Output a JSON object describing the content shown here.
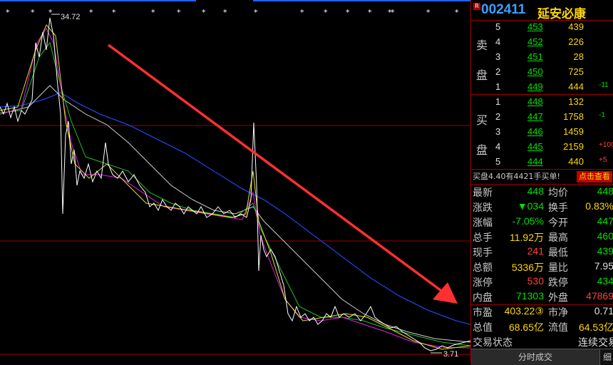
{
  "stock": {
    "code": "002411",
    "name": "延安必康",
    "badge": "R"
  },
  "chart": {
    "high_label": "34.72",
    "low_label": "3.71"
  },
  "orderbook": {
    "sell_label_1": "卖",
    "sell_label_2": "盘",
    "buy_label_1": "买",
    "buy_label_2": "盘",
    "asks": [
      {
        "level": "5",
        "price": "453",
        "volume": "439",
        "change": ""
      },
      {
        "level": "4",
        "price": "452",
        "volume": "226",
        "change": ""
      },
      {
        "level": "3",
        "price": "451",
        "volume": "28",
        "change": ""
      },
      {
        "level": "2",
        "price": "450",
        "volume": "725",
        "change": ""
      },
      {
        "level": "1",
        "price": "449",
        "volume": "444",
        "change": "-11"
      }
    ],
    "bids": [
      {
        "level": "1",
        "price": "448",
        "volume": "132",
        "change": ""
      },
      {
        "level": "2",
        "price": "447",
        "volume": "1758",
        "change": "-1"
      },
      {
        "level": "3",
        "price": "446",
        "volume": "1459",
        "change": ""
      },
      {
        "level": "4",
        "price": "445",
        "volume": "2159",
        "change": "+100"
      },
      {
        "level": "5",
        "price": "444",
        "volume": "440",
        "change": "+5"
      }
    ]
  },
  "notice": {
    "text": "买盘4.40有4421手买单!",
    "button": "点击查看"
  },
  "stats": [
    {
      "l1": "最新",
      "v1": "448",
      "c1": "g",
      "l2": "均价",
      "v2": "448",
      "c2": "g"
    },
    {
      "l1": "涨跌",
      "v1": "▼034",
      "c1": "g",
      "l2": "换手",
      "v2": "0.83%",
      "c2": "y"
    },
    {
      "l1": "涨幅",
      "v1": "-7.05%",
      "c1": "g",
      "l2": "今开",
      "v2": "447",
      "c2": "g"
    },
    {
      "l1": "总手",
      "v1": "11.92万",
      "c1": "y",
      "l2": "最高",
      "v2": "460",
      "c2": "g"
    },
    {
      "l1": "现手",
      "v1": "241",
      "c1": "r",
      "l2": "最低",
      "v2": "439",
      "c2": "g"
    },
    {
      "l1": "总额",
      "v1": "5336万",
      "c1": "y",
      "l2": "量比",
      "v2": "7.95",
      "c2": "w"
    },
    {
      "l1": "涨停",
      "v1": "530",
      "c1": "r",
      "l2": "跌停",
      "v2": "434",
      "c2": "g"
    },
    {
      "l1": "内盘",
      "v1": "71303",
      "c1": "g",
      "l2": "外盘",
      "v2": "47869",
      "c2": "r"
    }
  ],
  "market": [
    {
      "l1": "市盈",
      "v1": "403.22③",
      "c1": "y",
      "l2": "市净",
      "v2": "0.71",
      "c2": "w"
    },
    {
      "l1": "总值",
      "v1": "68.65亿",
      "c1": "y",
      "l2": "流值",
      "v2": "64.53亿",
      "c2": "y"
    },
    {
      "l1": "交易状态",
      "v1": "",
      "c1": "w",
      "l2": "",
      "v2": "连续交易",
      "c2": "w"
    }
  ],
  "tabs": {
    "tab1": "分时成交",
    "tab2": "细"
  },
  "colors": {
    "up": "#ff4040",
    "down": "#00e000",
    "accent": "#ffd700",
    "code": "#3aa0ff",
    "grid": "#a00000"
  }
}
